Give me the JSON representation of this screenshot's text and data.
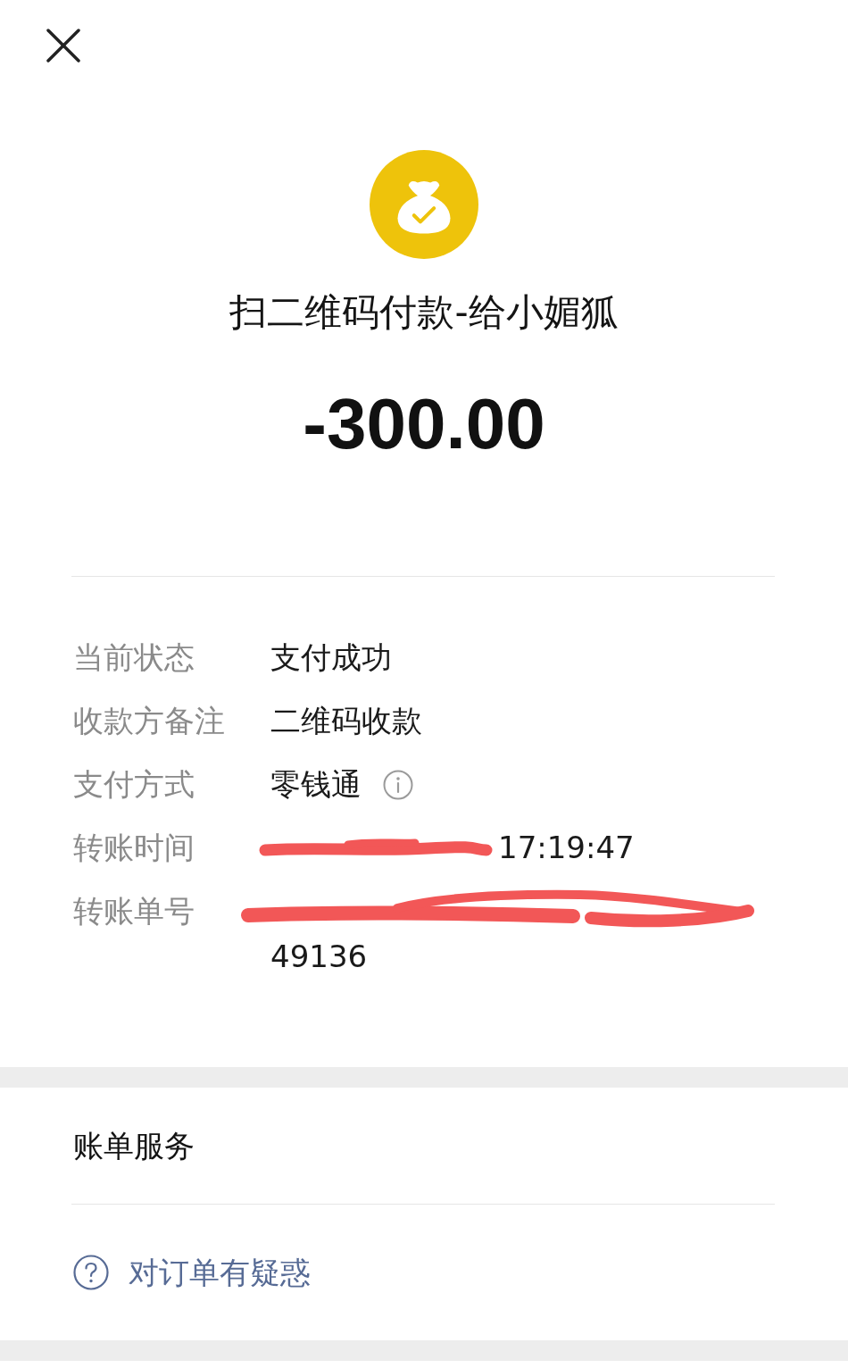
{
  "header": {
    "title": "扫二维码付款-给小媚狐",
    "amount": "-300.00"
  },
  "details": [
    {
      "kind": "text",
      "label": "当前状态",
      "value": "支付成功"
    },
    {
      "kind": "text",
      "label": "收款方备注",
      "value": "二维码收款"
    },
    {
      "kind": "info",
      "label": "支付方式",
      "value": "零钱通"
    },
    {
      "kind": "redacted_inline",
      "label": "转账时间",
      "value": "17:19:47"
    },
    {
      "kind": "redacted_block",
      "label": "转账单号",
      "value": "49136"
    }
  ],
  "bill_service": {
    "title": "账单服务",
    "link": "对订单有疑惑"
  }
}
